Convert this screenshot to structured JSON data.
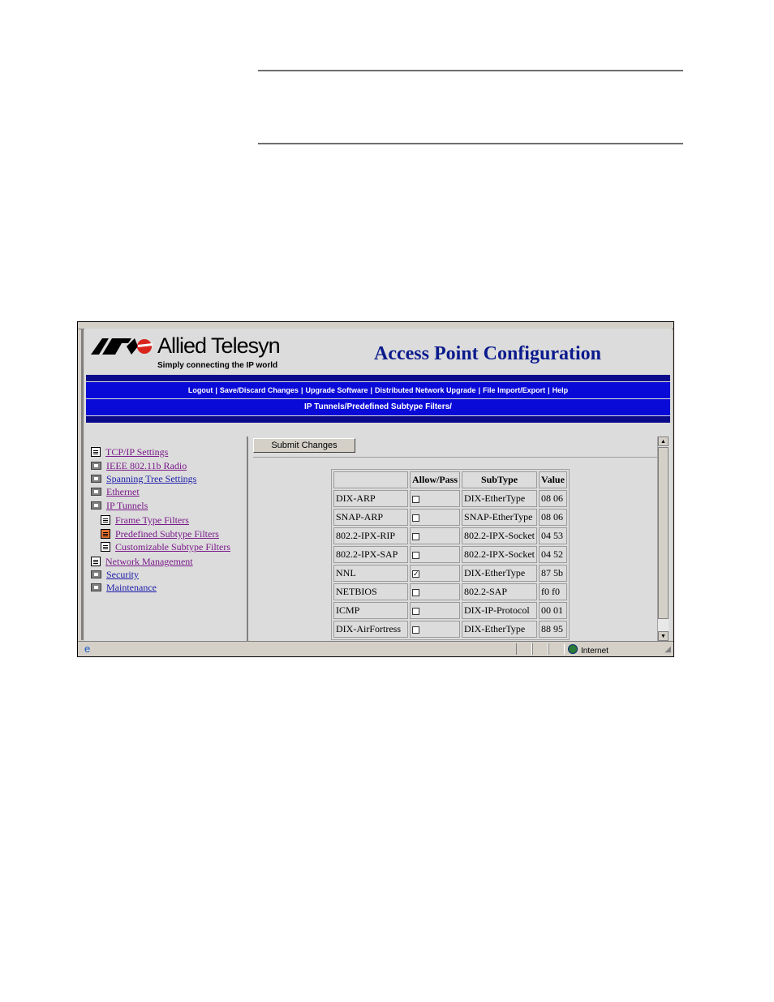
{
  "header": {
    "logo_name": "Allied Telesyn",
    "logo_tagline": "Simply connecting the IP world",
    "page_title": "Access Point Configuration"
  },
  "nav": {
    "items": [
      "Logout",
      "Save/Discard Changes",
      "Upgrade Software",
      "Distributed Network Upgrade",
      "File Import/Export",
      "Help"
    ]
  },
  "breadcrumb": "IP Tunnels/Predefined Subtype Filters/",
  "tree": {
    "items": [
      {
        "label": "TCP/IP Settings",
        "icon": "page-icon"
      },
      {
        "label": "IEEE 802.11b Radio",
        "icon": "folder-icon"
      },
      {
        "label": "Spanning Tree Settings",
        "icon": "folder-icon"
      },
      {
        "label": "Ethernet",
        "icon": "folder-icon"
      },
      {
        "label": "IP Tunnels",
        "icon": "folder-open-icon"
      },
      {
        "label": "Frame Type Filters",
        "icon": "page-icon"
      },
      {
        "label": "Predefined Subtype Filters",
        "icon": "page-icon"
      },
      {
        "label": "Customizable Subtype Filters",
        "icon": "page-icon"
      },
      {
        "label": "Network Management",
        "icon": "page-icon"
      },
      {
        "label": "Security",
        "icon": "folder-icon"
      },
      {
        "label": "Maintenance",
        "icon": "folder-icon"
      }
    ]
  },
  "form": {
    "submit_label": "Submit Changes"
  },
  "table": {
    "headers": [
      "",
      "Allow/Pass",
      "SubType",
      "Value"
    ],
    "rows": [
      {
        "name": "DIX-ARP",
        "allow": false,
        "subtype": "DIX-EtherType",
        "value": "08 06"
      },
      {
        "name": "SNAP-ARP",
        "allow": false,
        "subtype": "SNAP-EtherType",
        "value": "08 06"
      },
      {
        "name": "802.2-IPX-RIP",
        "allow": false,
        "subtype": "802.2-IPX-Socket",
        "value": "04 53"
      },
      {
        "name": "802.2-IPX-SAP",
        "allow": false,
        "subtype": "802.2-IPX-Socket",
        "value": "04 52"
      },
      {
        "name": "NNL",
        "allow": true,
        "subtype": "DIX-EtherType",
        "value": "87 5b"
      },
      {
        "name": "NETBIOS",
        "allow": false,
        "subtype": "802.2-SAP",
        "value": "f0 f0"
      },
      {
        "name": "ICMP",
        "allow": false,
        "subtype": "DIX-IP-Protocol",
        "value": "00 01"
      },
      {
        "name": "DIX-AirFortress",
        "allow": false,
        "subtype": "DIX-EtherType",
        "value": "88 95"
      }
    ]
  },
  "statusbar": {
    "zone": "Internet"
  },
  "colors": {
    "title": "#0b1a8c",
    "nav_bar": "#0a0ad8",
    "nav_border": "#0a0a8a",
    "link": "#1c1caa",
    "visited_link": "#7a1a8a"
  }
}
